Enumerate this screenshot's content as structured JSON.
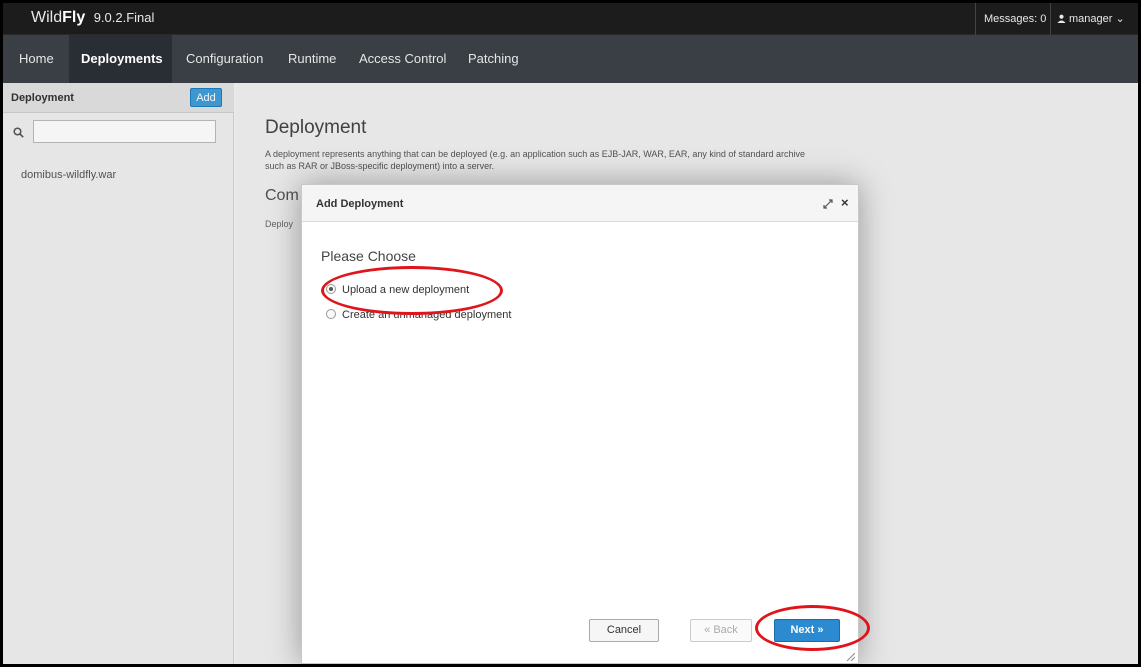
{
  "app": {
    "brand_wild": "Wild",
    "brand_fly": "Fly",
    "version": "9.0.2.Final",
    "messages": "Messages: 0",
    "user": "manager",
    "user_caret": "⌄"
  },
  "nav": {
    "tabs": [
      "Home",
      "Deployments",
      "Configuration",
      "Runtime",
      "Access Control",
      "Patching"
    ],
    "active": "Deployments"
  },
  "sidebar": {
    "title": "Deployment",
    "add_label": "Add",
    "search_value": "",
    "items": [
      "domibus-wildfly.war"
    ]
  },
  "main": {
    "title": "Deployment",
    "description": "A deployment represents anything that can be deployed (e.g. an application such as EJB-JAR, WAR, EAR, any kind of standard archive such as RAR or JBoss-specific deployment) into a server.",
    "subtitle": "Com",
    "subtitle_desc": "Deploy"
  },
  "modal": {
    "title": "Add Deployment",
    "close_glyph": "×",
    "prompt": "Please Choose",
    "options": [
      "Upload a new deployment",
      "Create an unmanaged deployment"
    ],
    "selected_option": "Upload a new deployment",
    "cancel_label": "Cancel",
    "back_label": "« Back",
    "next_label": "Next »"
  },
  "colors": {
    "brand_bar": "#1c1c1c",
    "nav_bar": "#393f44",
    "nav_active": "#292e34",
    "primary_button": "#2c8bd0",
    "annotation": "#e0151b"
  },
  "icons": {
    "search": "search-icon",
    "user": "user-icon",
    "expand": "expand-icon",
    "close": "close-icon",
    "resize": "resize-grip-icon"
  }
}
